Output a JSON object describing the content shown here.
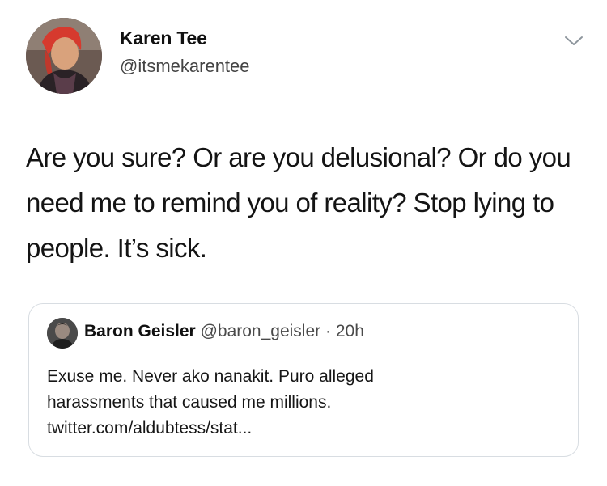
{
  "tweet": {
    "author_name": "Karen Tee",
    "author_handle": "@itsmekarentee",
    "avatar_icon": "user-avatar-photo",
    "menu_icon": "chevron-down-icon",
    "text": "Are you sure? Or are you delusional? Or do you need me to remind you of reality? Stop lying to people. It’s sick."
  },
  "quoted_tweet": {
    "author_name": "Baron Geisler",
    "author_handle": "@baron_geisler",
    "separator": "·",
    "timestamp": "20h",
    "avatar_icon": "user-avatar-photo",
    "text_lines": [
      "Exuse me. Never ako nanakit. Puro alleged",
      "harassments that caused me millions.",
      "twitter.com/aldubtess/stat..."
    ]
  },
  "colors": {
    "border": "#d8dde2",
    "text": "#141414",
    "secondary_text": "#4a4a4a"
  }
}
